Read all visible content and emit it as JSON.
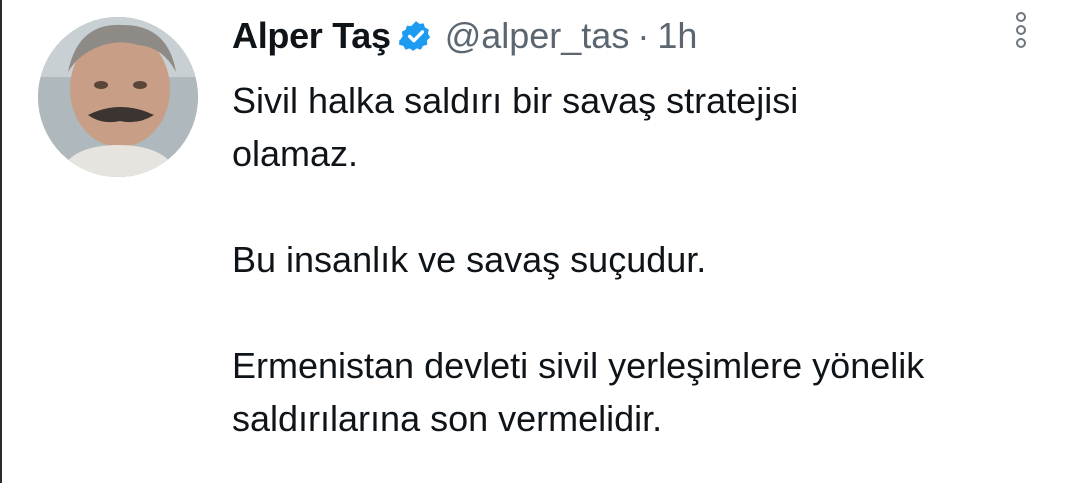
{
  "tweet": {
    "author": {
      "display_name": "Alper Taş",
      "handle": "@alper_tas",
      "verified_icon": "verified-badge-icon",
      "avatar": "profile-photo"
    },
    "separator": "·",
    "time": "1h",
    "menu_icon": "more-options-icon",
    "paragraphs": [
      "Sivil halka saldırı bir savaş stratejisi olamaz.",
      "Bu insanlık ve savaş suçudur.",
      "Ermenistan devleti sivil yerleşimlere yönelik saldırılarına son vermelidir."
    ]
  },
  "colors": {
    "text": "#0f1419",
    "secondary": "#5b6670",
    "verified": "#1d9bf0"
  }
}
